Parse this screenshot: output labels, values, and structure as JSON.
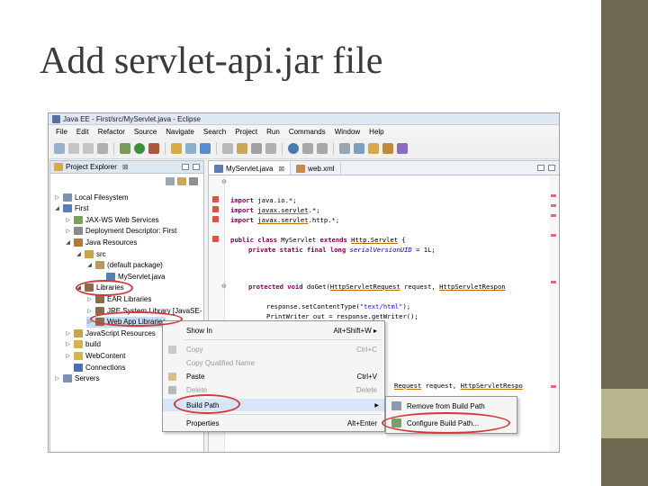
{
  "slide": {
    "title": "Add servlet-api.jar file"
  },
  "window": {
    "title": "Java EE - First/src/MyServlet.java - Eclipse"
  },
  "menubar": [
    "File",
    "Edit",
    "Refactor",
    "Source",
    "Navigate",
    "Search",
    "Project",
    "Run",
    "Commands",
    "Window",
    "Help"
  ],
  "explorer": {
    "tab_label": "Project Explorer",
    "close_glyph": "⊠",
    "tree": [
      {
        "label": "Local Filesystem",
        "indent": 0,
        "twisty": "▷",
        "icon_color": "#7b8fb0"
      },
      {
        "label": "First",
        "indent": 0,
        "twisty": "◢",
        "icon_color": "#5a7bb5"
      },
      {
        "label": "JAX-WS Web Services",
        "indent": 1,
        "twisty": "▷",
        "icon_color": "#7aa05a"
      },
      {
        "label": "Deployment Descriptor: First",
        "indent": 1,
        "twisty": "▷",
        "icon_color": "#8a8a8a"
      },
      {
        "label": "Java Resources",
        "indent": 1,
        "twisty": "◢",
        "icon_color": "#b07a3a"
      },
      {
        "label": "src",
        "indent": 2,
        "twisty": "◢",
        "icon_color": "#c9a24a"
      },
      {
        "label": "(default package)",
        "indent": 3,
        "twisty": "◢",
        "icon_color": "#b89a5a"
      },
      {
        "label": "MyServlet.java",
        "indent": 4,
        "twisty": "",
        "icon_color": "#5a7bb5"
      },
      {
        "label": "Libraries",
        "indent": 2,
        "twisty": "◢",
        "icon_color": "#8b6b4a"
      },
      {
        "label": "EAR Libraries",
        "indent": 3,
        "twisty": "▷",
        "icon_color": "#8b6b4a"
      },
      {
        "label": "JRE System Library [JavaSE-",
        "indent": 3,
        "twisty": "▷",
        "icon_color": "#8b6b4a",
        "annotated": true
      },
      {
        "label": "Web App Libraries",
        "indent": 3,
        "twisty": "▷",
        "icon_color": "#8b6b4a",
        "selected": true
      },
      {
        "label": "JavaScript Resources",
        "indent": 1,
        "twisty": "▷",
        "icon_color": "#c9a24a"
      },
      {
        "label": "build",
        "indent": 1,
        "twisty": "▷",
        "icon_color": "#d9b24a"
      },
      {
        "label": "WebContent",
        "indent": 1,
        "twisty": "▷",
        "icon_color": "#d9b24a"
      },
      {
        "label": "Connections",
        "indent": 1,
        "twisty": "",
        "icon_color": "#4a6fb5"
      },
      {
        "label": "Servers",
        "indent": 0,
        "twisty": "▷",
        "icon_color": "#7b8fb0"
      }
    ]
  },
  "editor": {
    "tabs": [
      {
        "label": "MyServlet.java",
        "close": "⊠",
        "active": true
      },
      {
        "label": "web.xml",
        "close": "",
        "active": false
      }
    ],
    "fold_markers": [
      "⊖",
      "⊖"
    ],
    "code": {
      "import1_kw": "import",
      "import1_pkg": "java.io.*;",
      "import2_kw": "import",
      "import2_pkg": "javax.servlet",
      "import2_tail": ".*;",
      "import3_kw": "import",
      "import3_pkg": "javax.servlet",
      "import3_tail": ".http.*;",
      "class_mods": "public class",
      "class_name": " MyServlet ",
      "class_ext": "extends",
      "class_super": "Http.Servlet",
      "class_brace": " {",
      "field_mods": "private static final long",
      "field_name": " serialVersionUID",
      "field_val": " = 1L;",
      "method_mod": "protected void",
      "method_name": " doGet(",
      "method_t1": "HttpServletRequest",
      "method_p1": " request, ",
      "method_t2": "HttpServletRespon",
      "resp_stmt": "response.setContentType(",
      "resp_str": "\"text/html\"",
      "resp_end": ");",
      "print_stmt": "PrintWriter out = response.getWriter();",
      "semi": ";",
      "dopost_t1": "Request",
      "dopost_p1": " request, ",
      "dopost_t2": "HttpServletRespo"
    }
  },
  "context_menu": {
    "items": [
      {
        "label": "Show In",
        "shortcut": "Alt+Shift+W ▸",
        "disabled": false
      },
      {
        "label": "Copy",
        "shortcut": "Ctrl+C",
        "disabled": true
      },
      {
        "label": "Copy Qualified Name",
        "shortcut": "",
        "disabled": true
      },
      {
        "label": "Paste",
        "shortcut": "Ctrl+V",
        "disabled": false
      },
      {
        "label": "Delete",
        "shortcut": "Delete",
        "disabled": true
      },
      {
        "label": "Build Path",
        "shortcut": "",
        "disabled": false,
        "submenu": true,
        "hover": true
      },
      {
        "label": "Properties",
        "shortcut": "Alt+Enter",
        "disabled": false
      }
    ],
    "submenu_arrow": "▶"
  },
  "submenu": {
    "items": [
      {
        "label": "Remove from Build Path"
      },
      {
        "label": "Configure Build Path..."
      }
    ]
  },
  "colors": {
    "annotation_red": "#d23a3a",
    "selection": "#c7dcf3",
    "keyword": "#7f0055",
    "string": "#2a00ff",
    "slide_bar_dark": "#6e6a52",
    "slide_bar_light": "#b8b48e"
  }
}
